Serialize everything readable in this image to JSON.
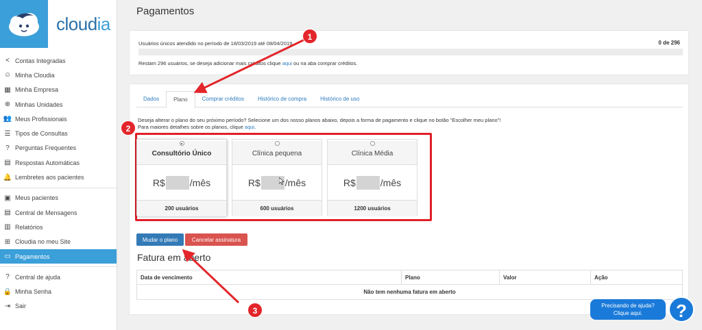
{
  "brand": {
    "name_part1": "cloud",
    "name_part2": "ia"
  },
  "page_title": "Pagamentos",
  "sidebar": {
    "groups": [
      [
        {
          "label": "Contas Integradas",
          "icon": "share-icon",
          "glyph": "<"
        },
        {
          "label": "Minha Cloudia",
          "icon": "face-icon",
          "glyph": "☺"
        },
        {
          "label": "Minha Empresa",
          "icon": "store-icon",
          "glyph": "▦"
        },
        {
          "label": "Minhas Unidades",
          "icon": "plus-circle-icon",
          "glyph": "⊕"
        },
        {
          "label": "Meus Profissionais",
          "icon": "people-icon",
          "glyph": "👥"
        },
        {
          "label": "Tipos de Consultas",
          "icon": "list-icon",
          "glyph": "☰"
        },
        {
          "label": "Perguntas Frequentes",
          "icon": "question-icon",
          "glyph": "?"
        },
        {
          "label": "Respostas Automáticas",
          "icon": "message-icon",
          "glyph": "▤"
        },
        {
          "label": "Lembretes aos pacientes",
          "icon": "bell-icon",
          "glyph": "🔔"
        }
      ],
      [
        {
          "label": "Meus pacientes",
          "icon": "contact-icon",
          "glyph": "▣"
        },
        {
          "label": "Central de Mensagens",
          "icon": "chat-icon",
          "glyph": "▤"
        },
        {
          "label": "Relatórios",
          "icon": "chart-icon",
          "glyph": "▥"
        },
        {
          "label": "Cloudia no meu Site",
          "icon": "widgets-icon",
          "glyph": "⊞"
        },
        {
          "label": "Pagamentos",
          "icon": "card-icon",
          "glyph": "▭",
          "active": true
        }
      ],
      [
        {
          "label": "Central de ajuda",
          "icon": "help-circle-icon",
          "glyph": "?"
        },
        {
          "label": "Minha Senha",
          "icon": "lock-icon",
          "glyph": "🔒"
        },
        {
          "label": "Sair",
          "icon": "logout-icon",
          "glyph": "⇥"
        }
      ]
    ]
  },
  "usage": {
    "label": "Usuários únicos atendido no período de 18/03/2019 até 08/04/2019",
    "count": "0 de 296",
    "progress_fraction": 0,
    "credits_prefix": "Restam 296 usuários, se deseja adicionar mais créditos clique ",
    "credits_link": "aqui",
    "credits_suffix": " ou na aba comprar créditos."
  },
  "tabs": [
    {
      "label": "Dados",
      "active": false
    },
    {
      "label": "Plano",
      "active": true
    },
    {
      "label": "Comprar créditos",
      "active": false
    },
    {
      "label": "Histórico de compra",
      "active": false
    },
    {
      "label": "Histórico de uso",
      "active": false
    }
  ],
  "intro": {
    "line1": "Deseja alterar o plano do seu próximo período? Selecione um dos nosso planos abaixo, depois a forma de pagamento e clique no botão \"Escolher meu plano\"!",
    "line2_prefix": "Para maiores detalhes sobre os planos, clique ",
    "line2_link": "aqui",
    "line2_suffix": "."
  },
  "plans": [
    {
      "name": "Consultório Único",
      "currency": "R$",
      "per": "/mês",
      "users": "200 usuários",
      "selected": true
    },
    {
      "name": "Clínica pequena",
      "currency": "R$",
      "per": "/mês",
      "users": "600 usuários",
      "selected": false
    },
    {
      "name": "Clínica Média",
      "currency": "R$",
      "per": "/mês",
      "users": "1200 usuários",
      "selected": false
    }
  ],
  "buttons": {
    "change_plan": "Mudar o plano",
    "cancel": "Cancelar assinatura"
  },
  "invoice": {
    "title": "Fatura em aberto",
    "columns": [
      "Data de vencimento",
      "Plano",
      "Valor",
      "Ação"
    ],
    "empty_message": "Não tem nenhuma fatura em aberto"
  },
  "help": {
    "line1": "Precisando de ajuda?",
    "line2": "Clique aqui.",
    "icon_glyph": "?"
  },
  "annotations": [
    "1",
    "2",
    "3"
  ],
  "colors": {
    "accent": "#3b9fd9",
    "primary_button": "#337ab7",
    "danger_button": "#d9534f",
    "annotation_red": "#e3262b"
  }
}
